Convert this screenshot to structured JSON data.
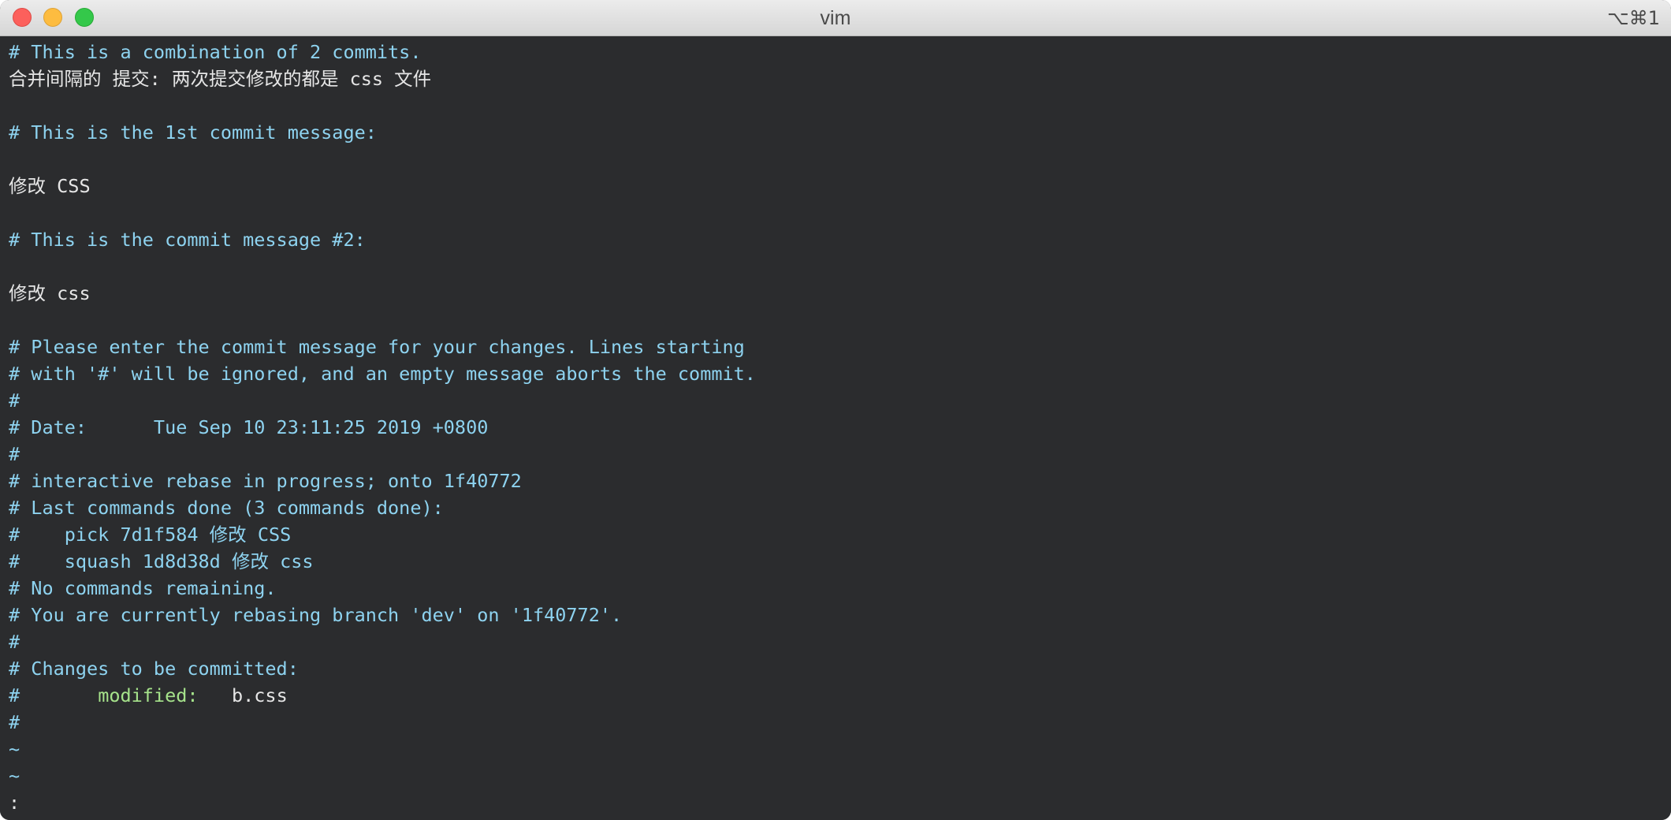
{
  "window": {
    "title": "vim",
    "shortcut": "⌥⌘1"
  },
  "buffer": {
    "l1": "# This is a combination of 2 commits.",
    "l2": "合并间隔的 提交: 两次提交修改的都是 css 文件",
    "l3": "# This is the 1st commit message:",
    "l4": "修改 CSS",
    "l5": "# This is the commit message #2:",
    "l6": "修改 css",
    "l7": "# Please enter the commit message for your changes. Lines starting",
    "l8": "# with '#' will be ignored, and an empty message aborts the commit.",
    "l9": "#",
    "l10": "# Date:      Tue Sep 10 23:11:25 2019 +0800",
    "l11": "#",
    "l12": "# interactive rebase in progress; onto 1f40772",
    "l13": "# Last commands done (3 commands done):",
    "l14": "#    pick 7d1f584 修改 CSS",
    "l15": "#    squash 1d8d38d 修改 css",
    "l16": "# No commands remaining.",
    "l17": "# You are currently rebasing branch 'dev' on '1f40772'.",
    "l18": "#",
    "l19": "# Changes to be committed:",
    "l20_prefix": "#       ",
    "l20_modified": "modified:",
    "l20_file": "   b.css",
    "l21": "#",
    "tilde1": "~",
    "tilde2": "~",
    "cmdline": ":"
  },
  "colors": {
    "background": "#2b2c2e",
    "comment": "#8ed3f0",
    "text": "#e6e6e6",
    "modified": "#a6e38b"
  }
}
